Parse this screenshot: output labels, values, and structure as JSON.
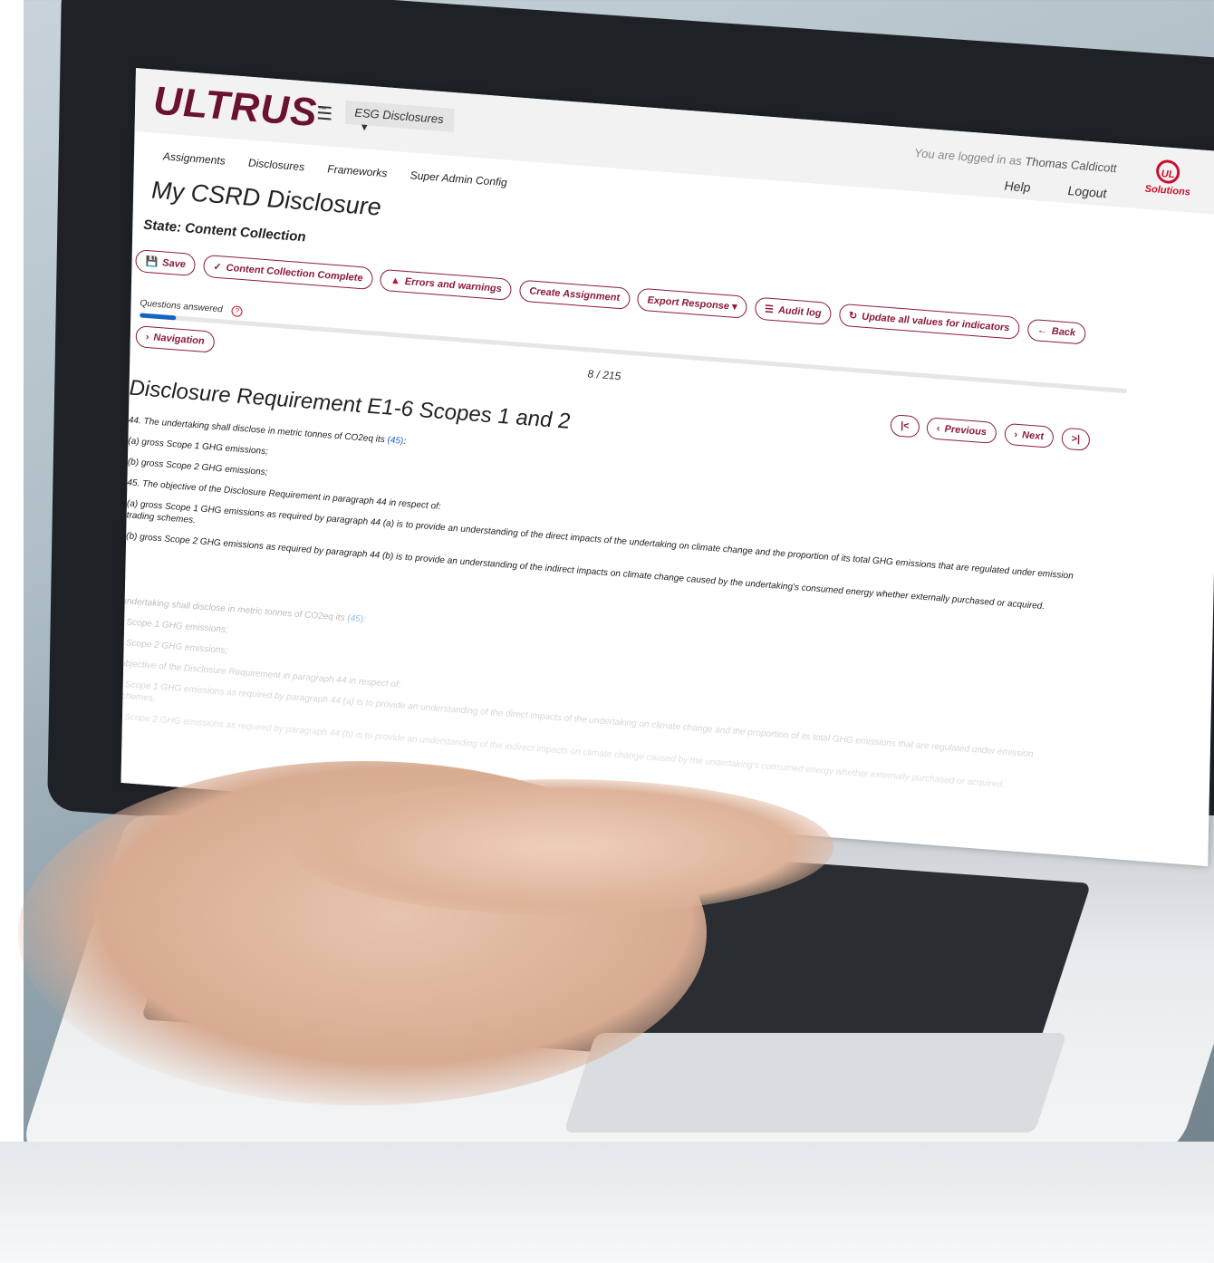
{
  "header": {
    "logo": "ULTRUS",
    "logo_tm": "™",
    "menu_icon": "hamburger-icon",
    "module_select": "ESG Disclosures",
    "logged_in_prefix": "You are logged in as",
    "user_name": "Thomas Caldicott",
    "help": "Help",
    "logout": "Logout",
    "ul_mark": "UL",
    "ul_solutions": "Solutions"
  },
  "nav": {
    "items": [
      "Assignments",
      "Disclosures",
      "Frameworks",
      "Super Admin Config"
    ]
  },
  "page": {
    "title": "My CSRD Disclosure",
    "state": "State: Content Collection"
  },
  "toolbar": {
    "save": "Save",
    "content_collection_complete": "Content Collection Complete",
    "errors_and_warnings": "Errors and warnings",
    "create_assignment": "Create Assignment",
    "export_response": "Export Response",
    "audit_log": "Audit log",
    "update_all": "Update all values for indicators",
    "back": "Back"
  },
  "progress": {
    "label": "Questions answered",
    "answered": 8,
    "total": 215,
    "count_text": "8 / 215",
    "fraction": 0.037
  },
  "navigation": {
    "label": "Navigation",
    "first": "|<",
    "previous": "Previous",
    "next": "Next",
    "last": ">|"
  },
  "requirement": {
    "title": "Disclosure Requirement E1-6 Scopes 1 and 2",
    "p44": "44. The undertaking shall disclose in metric tonnes of CO2eq its",
    "p44_ref": "(45)",
    "p44_end": ":",
    "p44a": "(a) gross Scope 1 GHG emissions;",
    "p44b": "(b) gross Scope 2 GHG emissions;",
    "p45": "45. The objective of the Disclosure Requirement in paragraph 44 in respect of:",
    "p45a": "(a) gross Scope 1 GHG emissions as required by paragraph 44 (a) is to provide an understanding of the direct impacts of the undertaking on climate change and the proportion of its total GHG emissions that are regulated under emission",
    "p45a_cont": "trading schemes.",
    "p45b": "(b) gross Scope 2 GHG emissions as required by paragraph 44 (b) is to provide an understanding of the indirect impacts on climate change caused by the undertaking's consumed energy whether externally purchased or acquired."
  }
}
